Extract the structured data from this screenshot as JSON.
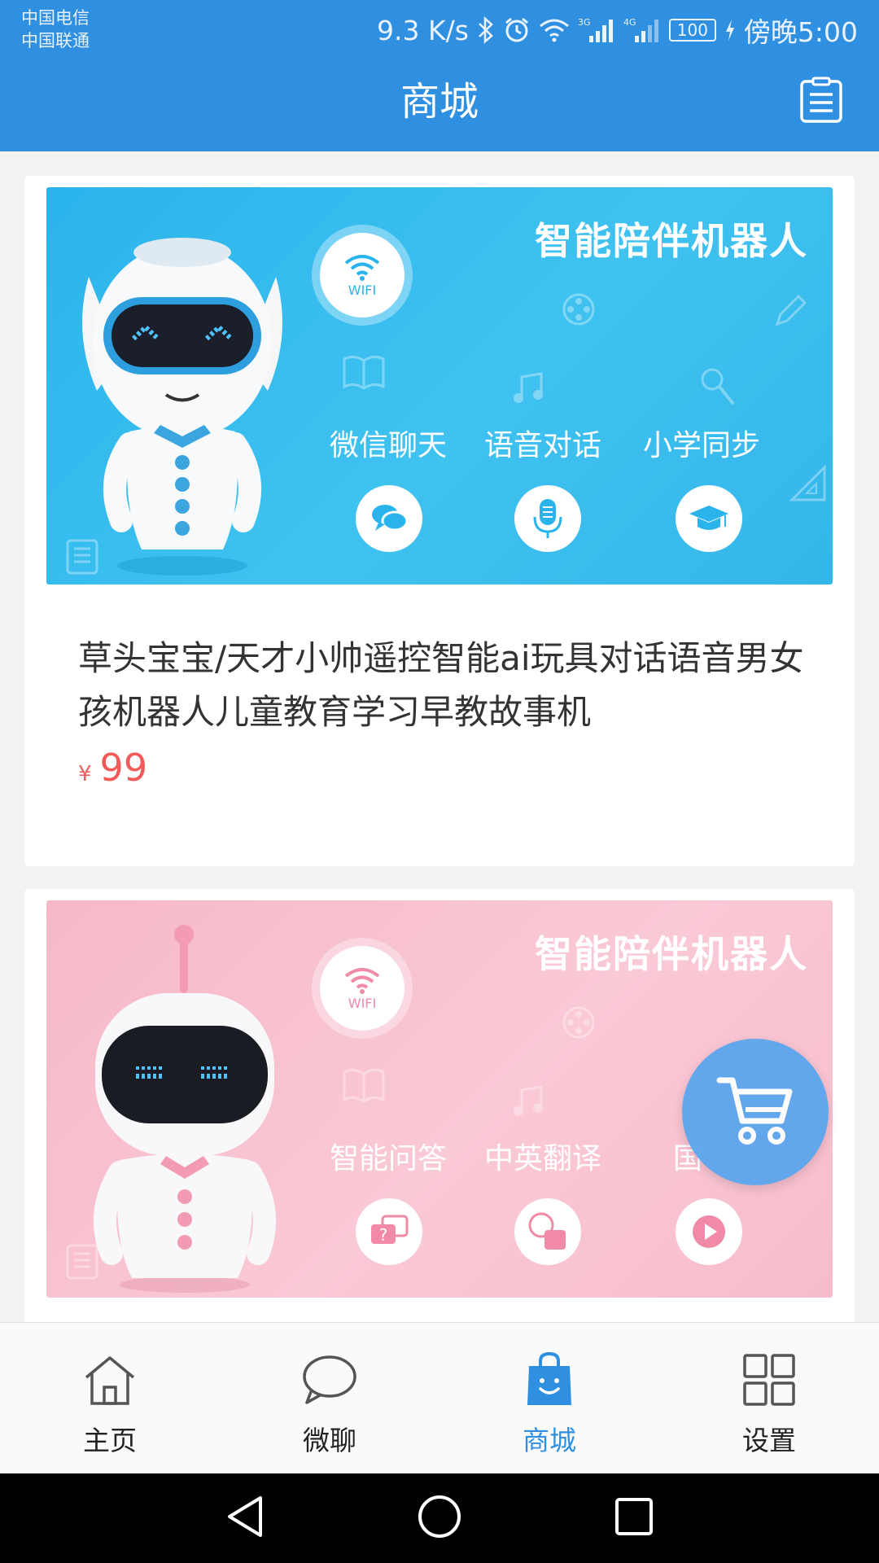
{
  "status_bar": {
    "carrier_1": "中国电信",
    "carrier_2": "中国联通",
    "speed": "9.3 K/s",
    "net_3g": "3G",
    "net_4g": "4G",
    "battery": "100",
    "time": "傍晚5:00"
  },
  "header": {
    "title": "商城",
    "menu_icon": "clipboard-list-icon"
  },
  "products": [
    {
      "banner": {
        "heading": "智能陪伴机器人",
        "wifi_label": "WIFI",
        "features": [
          "微信聊天",
          "语音对话",
          "小学同步"
        ],
        "feature_icons": [
          "chat-bubble-icon",
          "microphone-icon",
          "graduation-cap-icon"
        ],
        "theme_color": "#2bb4ec"
      },
      "name": "草头宝宝/天才小帅遥控智能ai玩具对话语音男女孩机器人儿童教育学习早教故事机",
      "currency": "¥",
      "price": "99"
    },
    {
      "banner": {
        "heading": "智能陪伴机器人",
        "wifi_label": "WIFI",
        "features": [
          "智能问答",
          "中英翻译",
          "国"
        ],
        "feature_icons": [
          "question-icon",
          "translate-icon",
          "play-icon"
        ],
        "theme_color": "#f6b8c8"
      }
    }
  ],
  "fab": {
    "icon": "shopping-cart-icon"
  },
  "tabs": [
    {
      "label": "主页",
      "icon": "home-icon",
      "active": false
    },
    {
      "label": "微聊",
      "icon": "chat-icon",
      "active": false
    },
    {
      "label": "商城",
      "icon": "shopping-bag-icon",
      "active": true
    },
    {
      "label": "设置",
      "icon": "grid-icon",
      "active": false
    }
  ],
  "colors": {
    "primary": "#2f8fe0",
    "price": "#f25a5a",
    "active_tab": "#2f8fe0"
  }
}
